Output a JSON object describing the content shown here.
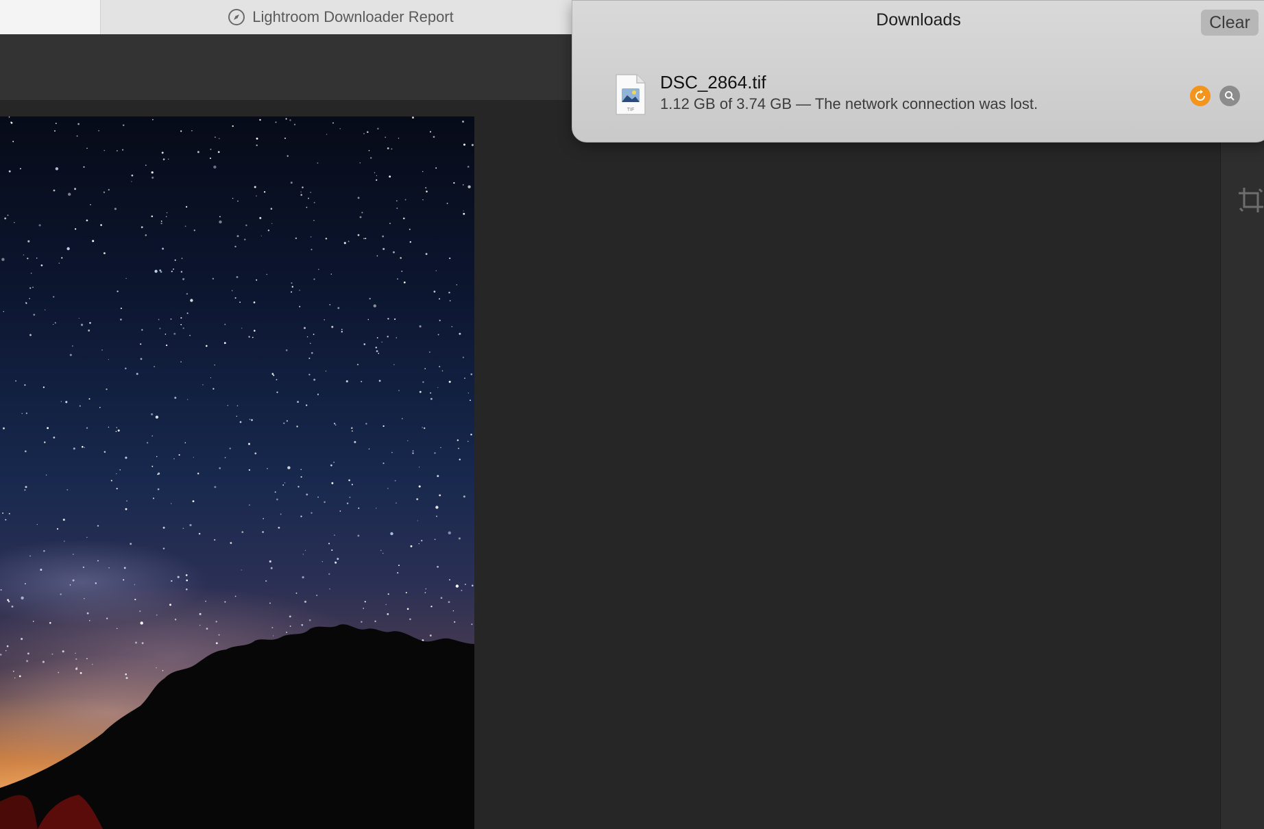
{
  "browser": {
    "active_tab": {
      "title": "Lightroom Downloader Report",
      "icon": "compass-icon"
    }
  },
  "downloads": {
    "title": "Downloads",
    "clear_label": "Clear",
    "items": [
      {
        "file_name": "DSC_2864.tif",
        "file_type_badge": "TIF",
        "status": "1.12 GB of 3.74 GB — The network connection was lost.",
        "downloaded": "1.12 GB",
        "total": "3.74 GB",
        "progress_fraction": 0.3,
        "resume_icon": "resume-icon",
        "reveal_icon": "magnifier-icon"
      }
    ]
  },
  "colors": {
    "resume_accent": "#f3941d",
    "popover_bg": "#d3d3d3",
    "app_bg": "#262626"
  },
  "side_panel": {
    "icons": [
      "sliders-icon",
      "crop-icon"
    ]
  }
}
